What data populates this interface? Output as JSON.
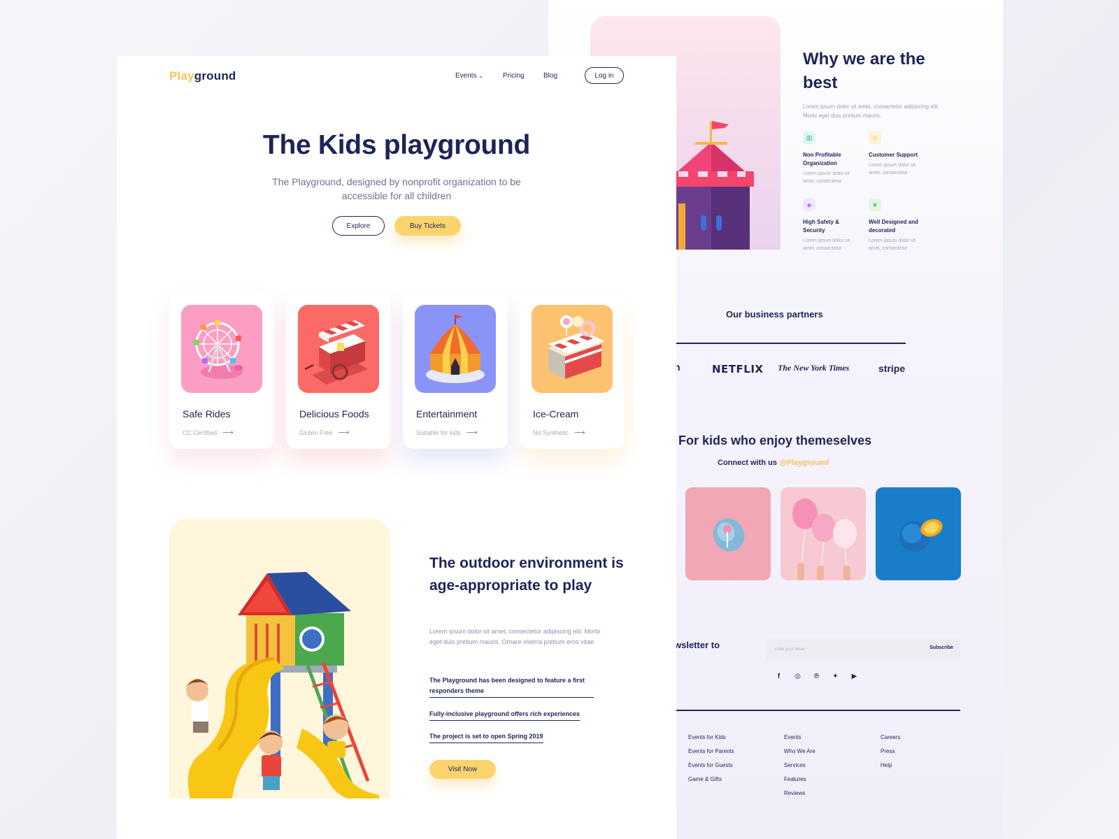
{
  "colors": {
    "navy": "#1f2456",
    "accent_yellow": "#f7c25e",
    "button_yellow": "#fbd46d"
  },
  "header": {
    "logo_part1": "Play",
    "logo_part2": "ground",
    "nav": {
      "events": "Events",
      "pricing": "Pricing",
      "blog": "Blog",
      "login": "Log in"
    }
  },
  "hero": {
    "title": "The Kids playground",
    "subtitle": "The Playground, designed by nonprofit organization to be accessible for all children",
    "explore": "Explore",
    "buy_tickets": "Buy Tickets"
  },
  "cards": [
    {
      "title": "Safe Rides",
      "subtitle": "CC Certified",
      "icon": "ferris-wheel-icon",
      "color": "#fc9dc4"
    },
    {
      "title": "Delicious Foods",
      "subtitle": "Gluten Free",
      "icon": "food-cart-icon",
      "color": "#fb6a66"
    },
    {
      "title": "Entertainment",
      "subtitle": "Suitable for kids",
      "icon": "circus-tent-icon",
      "color": "#8a94f7"
    },
    {
      "title": "Ice-Cream",
      "subtitle": "No Synthetic",
      "icon": "ice-cream-shop-icon",
      "color": "#fdc270"
    }
  ],
  "outdoor": {
    "title": "The outdoor environment  is age-appropriate to play",
    "text": "Lorem ipsum dolor sit amet, consectetur adipiscing elit. Morbi eget duis pretium mauris. Ornare viverra pretium eros vitae.",
    "links": [
      "The Playground has been designed to feature a first responders theme",
      "Fully-inclusive playground offers rich experiences",
      "The project is set to open Spring 2019"
    ],
    "visit": "Visit Now"
  },
  "why": {
    "title": "Why we are the best",
    "text": "Lorem ipsum dolor sit amet, consectetur adipiscing elit. Morbi eget duis pretium mauris.",
    "features": [
      {
        "title": "Non Profitable Organization",
        "text": "Lorem ipsum dolor sit amet, consectetur",
        "icon": "building-icon"
      },
      {
        "title": "Customer Support",
        "text": "Lorem ipsum dolor sit amet, consectetur",
        "icon": "support-icon"
      },
      {
        "title": "High Safety & Security",
        "text": "Lorem ipsum dolor sit amet, consectetur",
        "icon": "shield-icon"
      },
      {
        "title": "Well Designed and decorated",
        "text": "Lorem ipsum dolor sit amet, consectetur",
        "icon": "leaf-icon"
      }
    ]
  },
  "partners": {
    "title": "Our business partners",
    "logos": [
      "n",
      "NETFLIX",
      "The New York Times",
      "stripe"
    ]
  },
  "social": {
    "title": "For kids who enjoy themeselves",
    "connect": "Connect with us",
    "handle": "@Playground"
  },
  "newsletter": {
    "label": "wsletter to",
    "placeholder": "Enter your email",
    "subscribe": "Subscribe"
  },
  "footer": {
    "col1": [
      "Events for Kids",
      "Events for Parents",
      "Events for Guests",
      "Game & Gifts"
    ],
    "col2": [
      "Events",
      "Who We Are",
      "Services",
      "Features",
      "Reviews"
    ],
    "col3": [
      "Careers",
      "Press",
      "Help"
    ]
  }
}
